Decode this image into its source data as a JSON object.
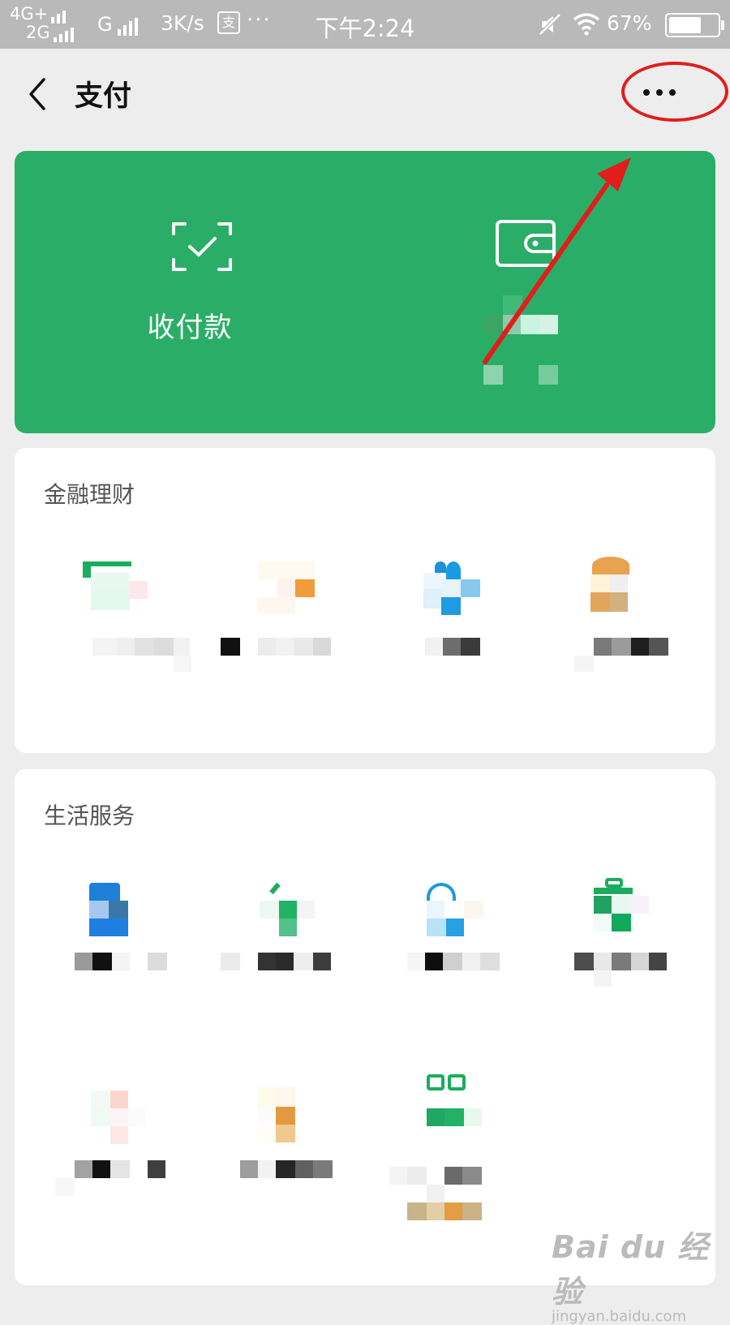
{
  "status_bar": {
    "network_top": "4G+",
    "network_bottom": "2G",
    "network_g": "G",
    "speed": "3K/s",
    "app_icon": "支",
    "more": "···",
    "time": "下午2:24",
    "battery_percent": "67%",
    "battery_level": 0.67,
    "icons": [
      "signal-icon",
      "mute-icon",
      "wifi-icon",
      "battery-icon"
    ]
  },
  "nav": {
    "title": "支付",
    "back_icon": "chevron-left-icon",
    "more_icon": "more-dots-icon"
  },
  "pay_card": {
    "color": "#2aae67",
    "collect": {
      "label": "收付款",
      "icon": "scan-check-icon"
    },
    "wallet": {
      "icon": "wallet-icon"
    }
  },
  "sections": [
    {
      "title": "金融理财",
      "items": 4
    },
    {
      "title": "生活服务",
      "items": 7
    }
  ],
  "watermark": {
    "main": "Bai du 经验",
    "sub": "jingyan.baidu.com"
  },
  "annotation_color": "#e31c1c"
}
